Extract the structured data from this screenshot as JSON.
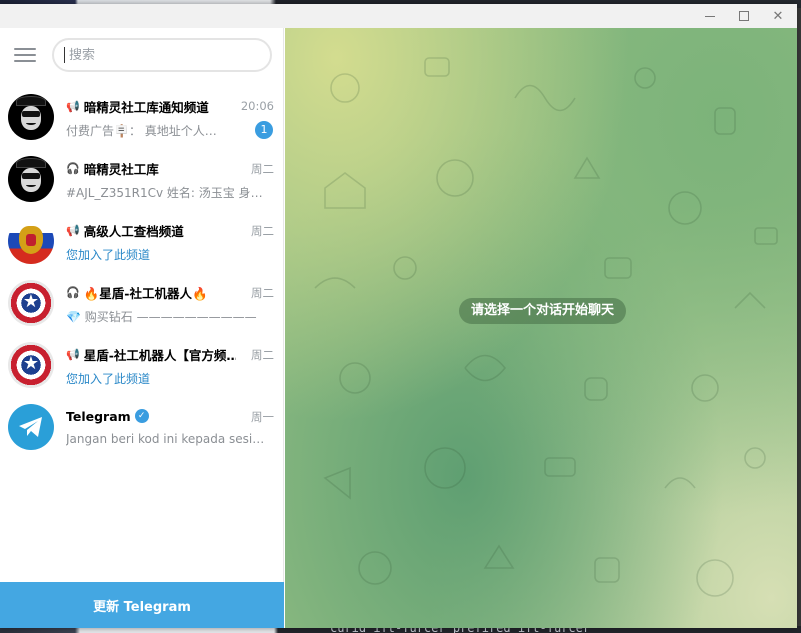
{
  "window": {
    "minimize_icon": "minimize-icon",
    "maximize_icon": "maximize-icon",
    "close_glyph": "✕"
  },
  "sidebar": {
    "search": {
      "placeholder": "搜索",
      "value": ""
    },
    "chats": [
      {
        "name": "暗精灵社工库通知频道",
        "type_icon": "📢",
        "time": "20:06",
        "preview": "付费广告🪧： 真地址个人…",
        "unread": "1",
        "avatar": "hood"
      },
      {
        "name": "暗精灵社工库",
        "type_icon": "🎧",
        "time": "周二",
        "preview": "#AJL_Z351R1Cv 姓名: 汤玉宝 身份…",
        "unread": "",
        "avatar": "hood"
      },
      {
        "name": "高级人工查档频道",
        "type_icon": "📢",
        "time": "周二",
        "preview": "您加入了此频道",
        "unread": "",
        "avatar": "russia-emblem"
      },
      {
        "name": "🔥星盾-社工机器人🔥",
        "type_icon": "🎧",
        "time": "周二",
        "preview": "💎 购买钻石 ——————————",
        "unread": "",
        "avatar": "shield"
      },
      {
        "name": "星盾-社工机器人【官方频…",
        "type_icon": "📢",
        "time": "周二",
        "preview": "您加入了此频道",
        "unread": "",
        "avatar": "shield"
      },
      {
        "name": "Telegram",
        "type_icon": "",
        "time": "周一",
        "preview": "Jangan beri kod ini kepada sesiap…",
        "unread": "",
        "avatar": "telegram",
        "verified": true
      }
    ],
    "update_button": "更新 Telegram"
  },
  "main": {
    "empty_label": "请选择一个对话开始聊天"
  },
  "desktop": {
    "bottom_text": "curid_ift-furcer  prefired_ift-furcer"
  },
  "colors": {
    "accent": "#44a7e2",
    "badge": "#3a9de0",
    "link": "#2a88c8"
  }
}
